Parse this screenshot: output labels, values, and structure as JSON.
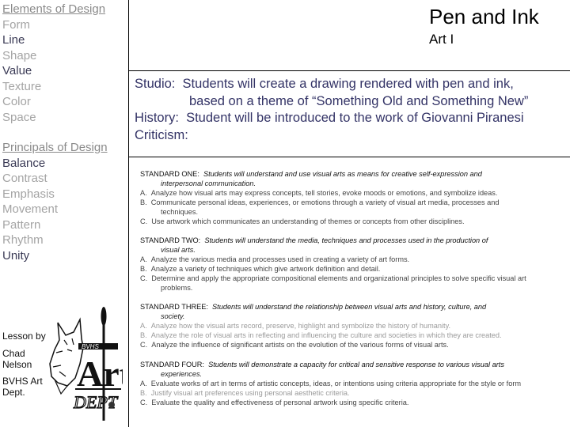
{
  "header": {
    "title": "Pen and Ink",
    "subtitle": "Art I"
  },
  "sidebar": {
    "elements_heading": "Elements of Design",
    "elements": [
      {
        "label": "Form",
        "tone": "gray"
      },
      {
        "label": "Line",
        "tone": "dark"
      },
      {
        "label": "Shape",
        "tone": "gray"
      },
      {
        "label": "Value",
        "tone": "dark"
      },
      {
        "label": "Texture",
        "tone": "gray"
      },
      {
        "label": "Color",
        "tone": "gray"
      },
      {
        "label": "Space",
        "tone": "gray"
      }
    ],
    "principles_heading": "Principals of Design",
    "principles": [
      {
        "label": "Balance",
        "tone": "dark"
      },
      {
        "label": "Contrast",
        "tone": "gray"
      },
      {
        "label": "Emphasis",
        "tone": "gray"
      },
      {
        "label": "Movement",
        "tone": "gray"
      },
      {
        "label": "Pattern",
        "tone": "gray"
      },
      {
        "label": "Rhythm",
        "tone": "gray"
      },
      {
        "label": "Unity",
        "tone": "dark"
      }
    ],
    "credit": {
      "line1": "Lesson by",
      "line2a": "Chad",
      "line2b": "Nelson",
      "line3a": "BVHS Art",
      "line3b": "Dept."
    },
    "logo": {
      "icon": "lynx-art-dept-logo-icon",
      "text_top": "BVHS",
      "text_art": "Art",
      "text_dept": "DEPT"
    }
  },
  "objectives": {
    "studio_label": "Studio:",
    "studio_line1": "Students will create a drawing rendered with pen and ink,",
    "studio_line2": "based on a theme of “Something Old and Something New”",
    "history_label": "History:",
    "history_text": "Student will be introduced to the work of Giovanni Piranesi",
    "criticism_label": "Criticism:"
  },
  "standards": [
    {
      "label": "STANDARD ONE:",
      "text1": "Students will understand and use visual arts as means for creative self-expression and",
      "text2": "interpersonal communication.",
      "items": [
        {
          "letter": "A.",
          "lines": [
            "Analyze how visual arts may express concepts, tell stories, evoke moods or emotions, and symbolize ideas."
          ],
          "tone": "mid"
        },
        {
          "letter": "B.",
          "lines": [
            "Communicate personal ideas, experiences, or emotions through a variety of visual art media, processes and",
            "techniques."
          ],
          "tone": "mid"
        },
        {
          "letter": "C.",
          "lines": [
            "Use artwork which communicates an understanding of themes or concepts from other disciplines."
          ],
          "tone": "mid"
        }
      ]
    },
    {
      "label": "STANDARD TWO:",
      "text1": "Students will understand the media, techniques and processes used in the production of",
      "text2": "visual arts.",
      "items": [
        {
          "letter": "A.",
          "lines": [
            "Analyze the various media and processes used in creating a variety of art forms."
          ],
          "tone": "mid"
        },
        {
          "letter": "B.",
          "lines": [
            "Analyze a variety of techniques which give artwork definition and detail."
          ],
          "tone": "mid"
        },
        {
          "letter": "C.",
          "lines": [
            "Determine and apply the appropriate compositional elements and organizational principles to solve specific visual art",
            "problems."
          ],
          "tone": "mid"
        }
      ]
    },
    {
      "label": "STANDARD THREE:",
      "text1": "Students will understand the relationship between visual arts and history, culture, and",
      "text2": "society.",
      "items": [
        {
          "letter": "A.",
          "lines": [
            "Analyze how the visual arts record, preserve, highlight and symbolize the history of humanity."
          ],
          "tone": "gray"
        },
        {
          "letter": "B.",
          "lines": [
            "Analyze the role of visual arts in reflecting and influencing the culture and societies in which they are created."
          ],
          "tone": "gray"
        },
        {
          "letter": "C.",
          "lines": [
            "Analyze the influence of significant artists on the evolution of the various forms of visual arts."
          ],
          "tone": "mid"
        }
      ]
    },
    {
      "label": "STANDARD FOUR:",
      "text1": "Students will demonstrate a capacity for critical and sensitive response to various visual arts",
      "text2": "experiences.",
      "items": [
        {
          "letter": "A.",
          "lines": [
            "Evaluate works of art in terms of artistic concepts, ideas, or intentions using criteria appropriate for the style or  form"
          ],
          "tone": "mid"
        },
        {
          "letter": "B.",
          "lines": [
            "Justify visual art preferences using personal aesthetic criteria."
          ],
          "tone": "gray"
        },
        {
          "letter": "C.",
          "lines": [
            "Evaluate the quality and effectiveness of personal artwork using specific criteria."
          ],
          "tone": "mid"
        }
      ]
    }
  ]
}
